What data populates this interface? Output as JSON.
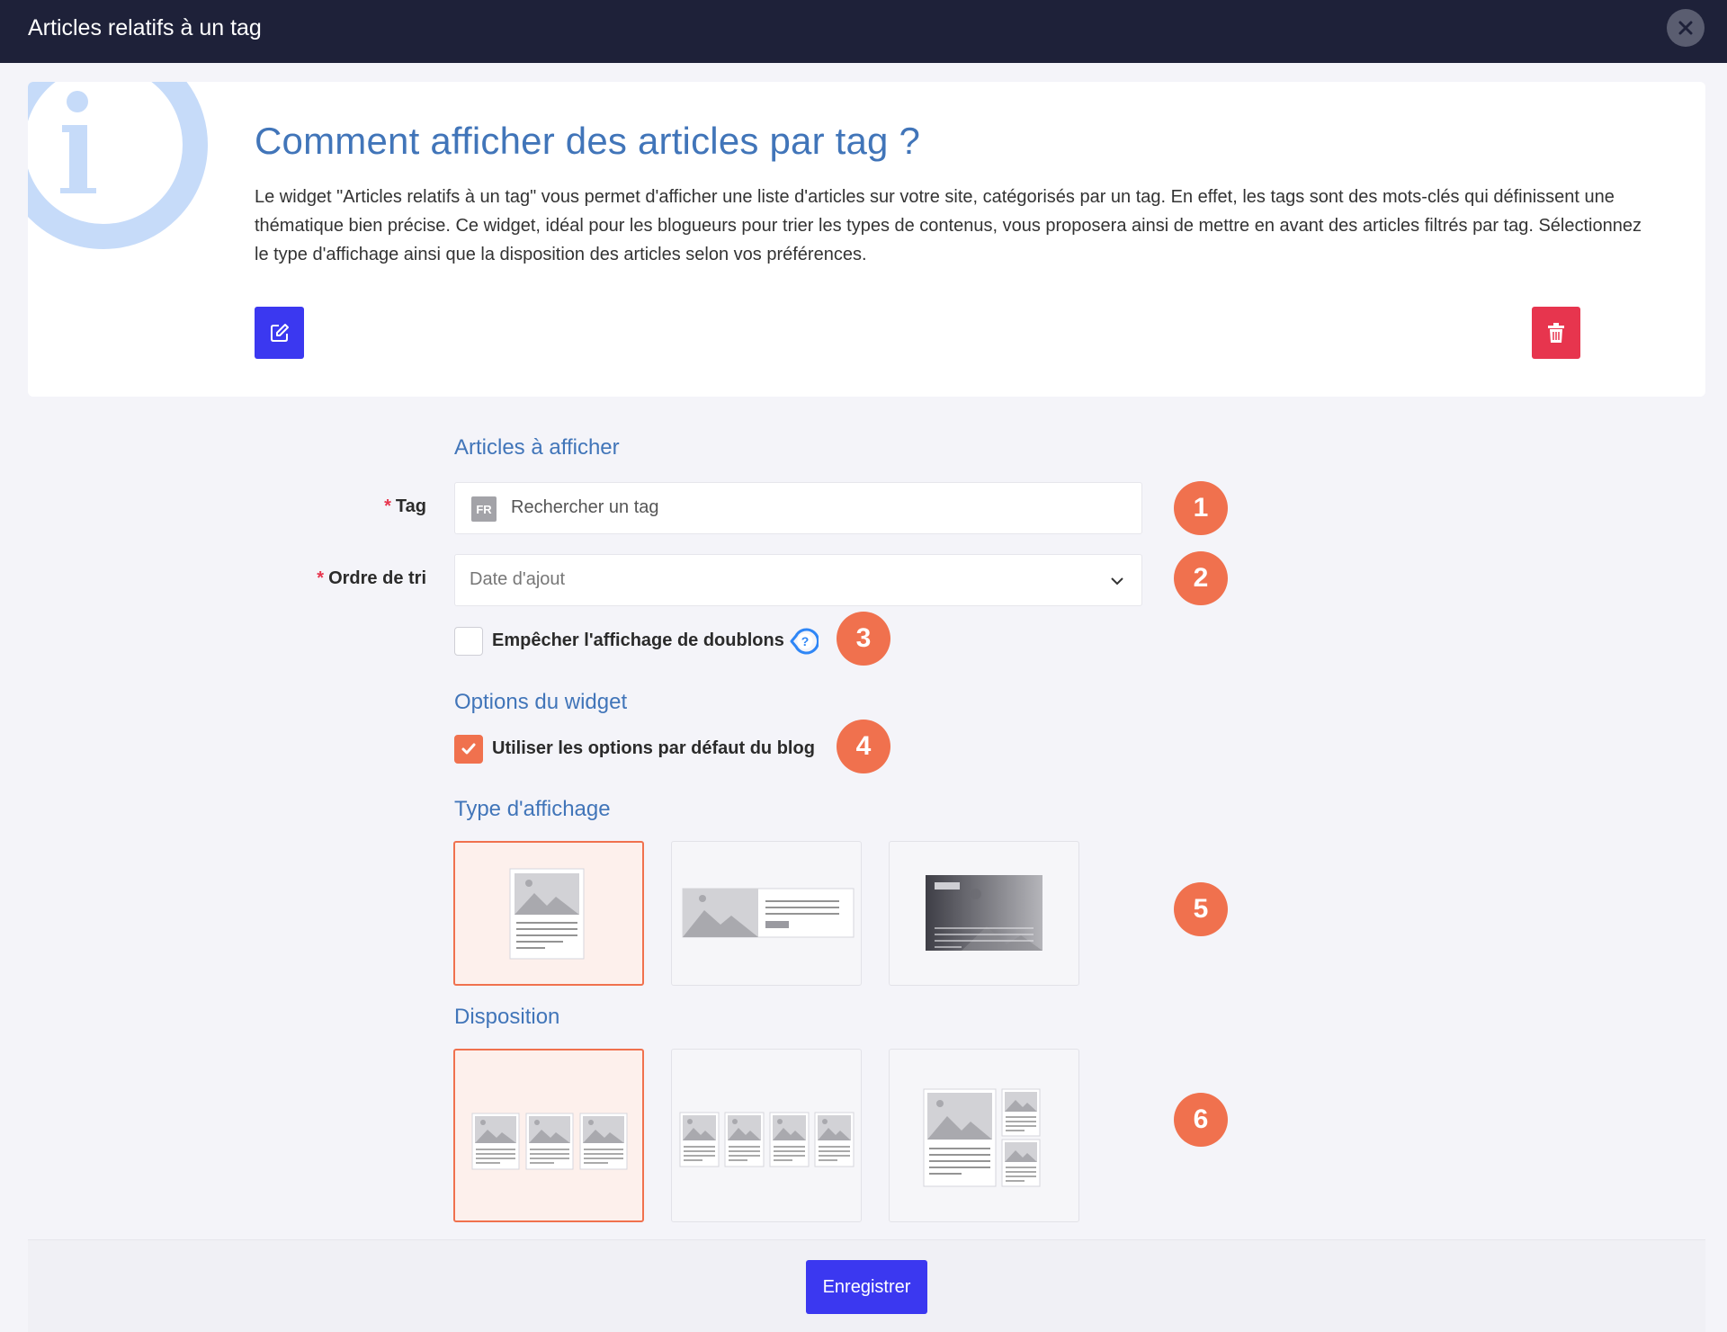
{
  "window": {
    "title": "Articles relatifs à un tag"
  },
  "info": {
    "title": "Comment afficher des articles par tag ?",
    "text": "Le widget \"Articles relatifs à un tag\" vous permet d'afficher une liste d'articles sur votre site, catégorisés par un tag. En effet, les tags sont des mots-clés qui définissent une thématique bien précise. Ce widget, idéal pour les blogueurs pour trier les types de contenus, vous proposera ainsi de mettre en avant des articles filtrés par tag. Sélectionnez le type d'affichage ainsi que la disposition des articles selon vos préférences."
  },
  "form": {
    "articles_section": "Articles à afficher",
    "tag": {
      "label": "Tag",
      "required_mark": "*",
      "lang_badge": "FR",
      "placeholder": "Rechercher un tag"
    },
    "sort": {
      "label": "Ordre de tri",
      "required_mark": "*",
      "value": "Date d'ajout"
    },
    "no_duplicates": {
      "label": "Empêcher l'affichage de doublons",
      "checked": false
    },
    "options_section": "Options du widget",
    "use_defaults": {
      "label": "Utiliser les options par défaut du blog",
      "checked": true
    },
    "display_section": "Type d'affichage",
    "display_types": [
      {
        "name": "card",
        "selected": true
      },
      {
        "name": "horizontal",
        "selected": false
      },
      {
        "name": "overlay",
        "selected": false
      }
    ],
    "layout_section": "Disposition",
    "layouts": [
      {
        "name": "3-columns",
        "selected": true
      },
      {
        "name": "4-columns",
        "selected": false
      },
      {
        "name": "featured-grid",
        "selected": false
      }
    ]
  },
  "steps": [
    "1",
    "2",
    "3",
    "4",
    "5",
    "6"
  ],
  "footer": {
    "save_label": "Enregistrer"
  },
  "colors": {
    "accent": "#f0714e",
    "primary": "#3b38f0",
    "danger": "#e7354e",
    "header": "#1e2139",
    "heading": "#4175b9"
  }
}
